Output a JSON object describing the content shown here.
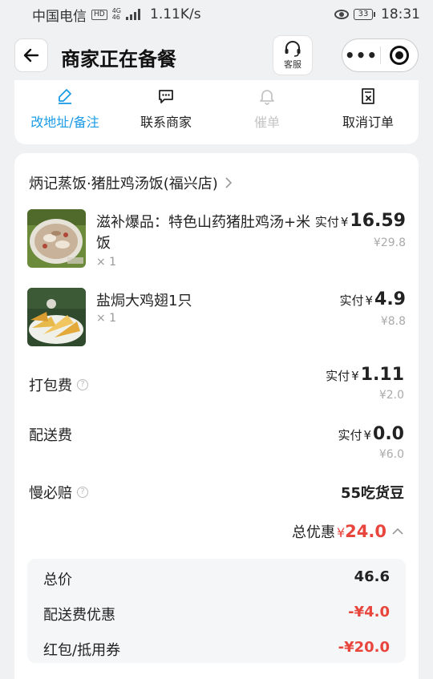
{
  "status_bar": {
    "carrier": "中国电信",
    "hd_label": "HD",
    "net_type_top": "4G",
    "net_type_bottom": "46",
    "speed": "1.11K/s",
    "battery": "33",
    "time": "18:31"
  },
  "nav": {
    "title": "商家正在备餐",
    "customer_service_label": "客服",
    "more_label": "•••"
  },
  "actions": [
    {
      "label": "改地址/备注",
      "state": "active"
    },
    {
      "label": "联系商家",
      "state": "normal"
    },
    {
      "label": "催单",
      "state": "disabled"
    },
    {
      "label": "取消订单",
      "state": "normal"
    }
  ],
  "order": {
    "shop_name": "炳记蒸饭·猪肚鸡汤饭(福兴店)",
    "items": [
      {
        "name": "滋补爆品：特色山药猪肚鸡汤+米饭",
        "qty": "× 1",
        "paid_label": "实付",
        "currency": "¥",
        "paid": "16.59",
        "original": "¥29.8"
      },
      {
        "name": "盐焗大鸡翅1只",
        "qty": "× 1",
        "paid_label": "实付",
        "currency": "¥",
        "paid": "4.9",
        "original": "¥8.8"
      }
    ],
    "fees": [
      {
        "label": "打包费",
        "has_help": true,
        "paid_label": "实付",
        "currency": "¥",
        "paid": "1.11",
        "original": "¥2.0"
      },
      {
        "label": "配送费",
        "has_help": false,
        "paid_label": "实付",
        "currency": "¥",
        "paid": "0.0",
        "original": "¥6.0"
      }
    ],
    "guarantee": {
      "label": "慢必赔",
      "value": "55吃货豆"
    },
    "total_discount": {
      "label": "总优惠",
      "currency": "¥",
      "value": "24.0"
    },
    "summary": [
      {
        "label": "总价",
        "value": "46.6",
        "red": false
      },
      {
        "label": "配送费优惠",
        "value": "-¥4.0",
        "red": true
      },
      {
        "label": "红包/抵用券",
        "value": "-¥20.0",
        "red": true
      }
    ]
  },
  "colors": {
    "accent": "#1a9be6",
    "discount_red": "#e8453c",
    "background": "#f0f1f3"
  }
}
